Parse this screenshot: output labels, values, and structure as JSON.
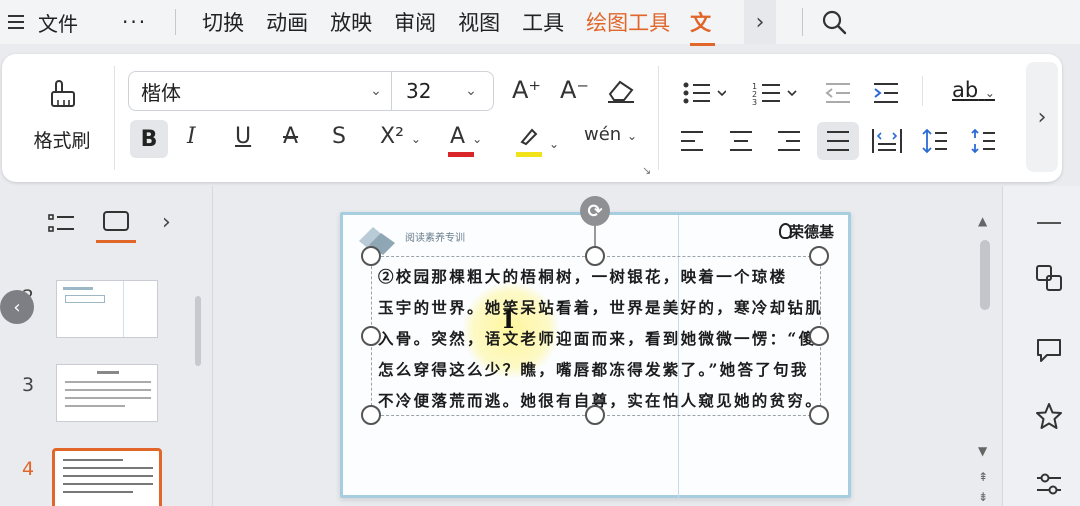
{
  "menubar": {
    "file_label": "文件",
    "more_label": "···",
    "tabs": [
      "切换",
      "动画",
      "放映",
      "审阅",
      "视图",
      "工具"
    ],
    "context_tab": "绘图工具",
    "active_tab": "文"
  },
  "ribbon": {
    "format_painter_label": "格式刷",
    "font_name": "楷体",
    "font_size": "32",
    "increase_font": "A⁺",
    "decrease_font": "A⁻",
    "bold": "B",
    "italic": "I",
    "underline": "U",
    "strike": "A",
    "shadow": "S",
    "superscript": "X²",
    "font_color_glyph": "A",
    "phonetic_glyph": "wén",
    "text_direction_glyph": "ab"
  },
  "slides_panel": {
    "thumb_numbers": [
      "3",
      "4"
    ],
    "partial_number": "2"
  },
  "slide": {
    "header_text": "阅读素养专训",
    "brand": "荣德基",
    "lines": [
      "②校园那棵粗大的梧桐树，一树银花，映着一个琼楼",
      "玉宇的世界。她笑呆站看着，世界是美好的，寒冷却钻肌",
      "入骨。突然，语文老师迎面而来，看到她微微一愣：“傻",
      "怎么穿得这么少？瞧，嘴唇都冻得发紫了。”她答了句我",
      "不冷便落荒而逃。她很有自尊，实在怕人窥见她的贫穷。"
    ]
  },
  "colors": {
    "accent": "#e0662a",
    "font_color_bar": "#d9262b",
    "highlight_bar": "#f2e21a",
    "slide_border": "#a7cde0"
  }
}
